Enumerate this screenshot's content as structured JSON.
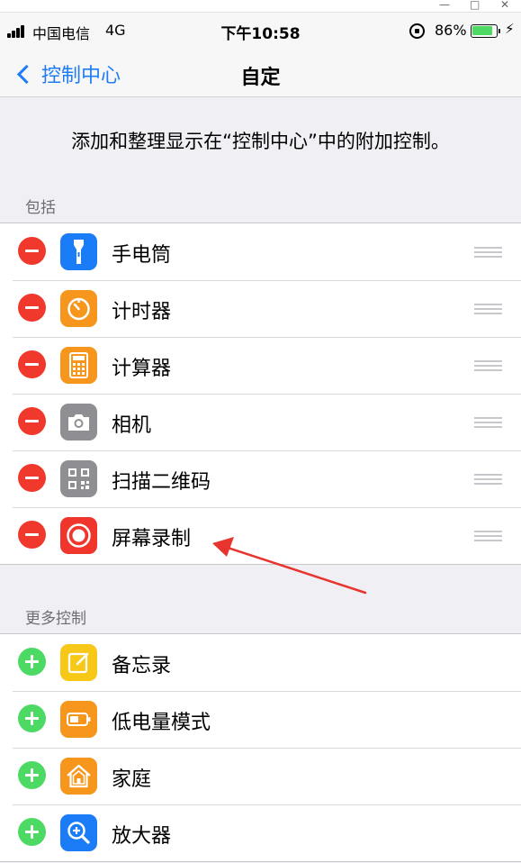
{
  "window_controls": {
    "minimize": "—",
    "maximize": "□",
    "close": "✕"
  },
  "status_bar": {
    "carrier": "中国电信",
    "network": "4G",
    "time": "下午10:58",
    "battery_percent": "86%",
    "charging_glyph": "⚡",
    "battery_level": 0.86
  },
  "nav": {
    "back_label": "控制中心",
    "title": "自定"
  },
  "description": "添加和整理显示在“控制中心”中的附加控制。",
  "sections": {
    "included": {
      "header": "包括",
      "items": [
        {
          "label": "手电筒",
          "icon": "flashlight-icon",
          "color": "#1a7cf6"
        },
        {
          "label": "计时器",
          "icon": "timer-icon",
          "color": "#f6961c"
        },
        {
          "label": "计算器",
          "icon": "calculator-icon",
          "color": "#f6961c"
        },
        {
          "label": "相机",
          "icon": "camera-icon",
          "color": "#8e8e93"
        },
        {
          "label": "扫描二维码",
          "icon": "qr-code-icon",
          "color": "#8e8e93"
        },
        {
          "label": "屏幕录制",
          "icon": "screen-recording-icon",
          "color": "#f0362c"
        }
      ]
    },
    "more": {
      "header": "更多控制",
      "items": [
        {
          "label": "备忘录",
          "icon": "notes-icon",
          "color": "#f8c818"
        },
        {
          "label": "低电量模式",
          "icon": "low-power-icon",
          "color": "#f6961c"
        },
        {
          "label": "家庭",
          "icon": "home-icon",
          "color": "#f6961c"
        },
        {
          "label": "放大器",
          "icon": "magnifier-icon",
          "color": "#1a7cf6"
        }
      ]
    }
  },
  "colors": {
    "accent": "#1f7cf3",
    "remove": "#f0382d",
    "add": "#4cd964",
    "annotation": "#e8342e"
  }
}
